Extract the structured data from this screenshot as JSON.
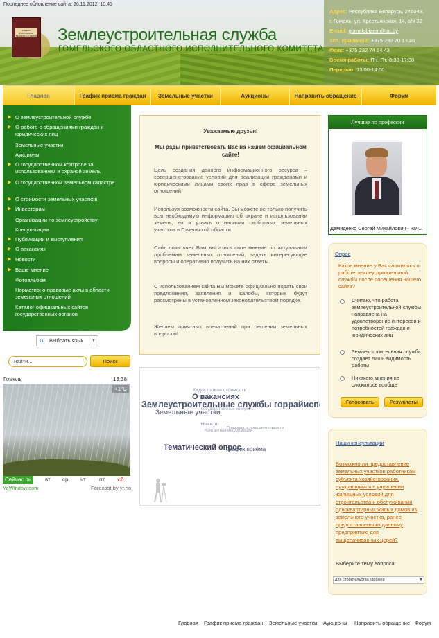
{
  "header": {
    "last_update": "Последнее обновление сайта: 26.11.2012, 10:45",
    "title_main": "Землеустроительная служба",
    "title_sub": "ГОМЕЛЬСКОГО ОБЛАСТНОГО ИСПОЛНИТЕЛЬНОГО КОМИТЕТА",
    "logo_text": "КОДЕКС РЕСПУБЛИКИ БЕЛАРУСЬ О ЗЕМЛЕ",
    "contacts": {
      "address_key": "Адрес:",
      "address_val": "Республика Беларусь, 246048,",
      "address_val2": "г. Гомель, ул. Крестьянская, 14, а/я 32",
      "email_key": "E-mail:",
      "email_val": "gomelobizem@tut.by",
      "phone_key": "Тел. приёмной:",
      "phone_val": "+375 232 70 13 46",
      "fax_key": "Факс:",
      "fax_val": "+375 232 74 54 43",
      "hours_key": "Время работы:",
      "hours_val": "Пн.-Пт. 8:30-17:30",
      "break_key": "Перерыв:",
      "break_val": "13:00-14:00"
    }
  },
  "topnav": [
    "Главная",
    "График приема граждан",
    "Земельные участки",
    "Аукционы",
    "Направить обращение",
    "Форум"
  ],
  "leftnav": [
    "О землеустроительной службе",
    "О работе с обращениями граждан и юридических лиц",
    "Земельные участки",
    "Аукционы",
    "О государственном контроле за использованием и охраной земель",
    "О государственном земельном кадастре",
    "О стоимости земельных участков",
    "Инвесторам",
    "Организации по землеустройству",
    "Консультации",
    "Публикации и выступления",
    "О вакансиях",
    "Новости",
    "Ваше мнение",
    "Фотоальбом",
    "Нормативно-правовые акты в области земельных отношений",
    "Каталог официальных сайтов государственных органов"
  ],
  "translate_label": "Выбрать язык",
  "search": {
    "placeholder": "найти...",
    "button": "Поиск"
  },
  "weather": {
    "city": "Гомель",
    "time": "13:38",
    "temp": "+1°C",
    "days": [
      "Сейчас пн",
      "вт",
      "ср",
      "чт",
      "пт",
      "сб"
    ],
    "brand": "YoWindow.com",
    "forecast": "Forecast by yr.no"
  },
  "welcome": {
    "h1": "Уважаемые друзья!",
    "h2": "Мы рады приветствовать Вас на нашем официальном сайте!",
    "p1": "Цель создания данного информационного ресурса – совершенствование условий для реализации гражданами и юридическими лицами своих прав в сфере земельных отношений.",
    "p2": "Используя возможности сайта, Вы можете не только получить всю необходимую информацию об охране и использовании земель, но и узнать о наличии свободных земельных участков в Гомельской области.",
    "p3": "Сайт позволяет Вам выразить свое мнение по актуальным проблемам земельных отношений, задать интересующие вопросы и оперативно получить на них ответы.",
    "p4": "С использованием сайта Вы можете официально подать свои предложения, заявления и жалобы, которые будут рассмотрены в установленном законодательством порядке.",
    "p5": "Желаем приятных впечатлений при решении земельных вопросов!"
  },
  "cloud": [
    "Кадастровая стоимость",
    "О вакансиях",
    "Землеустроительные службы горрайисполкомов",
    "Государственный контроль",
    "Земельные участки",
    "Новости",
    "Правовая основа деятельности",
    "Контактная информация",
    "Тематический опрос",
    "График приёма"
  ],
  "best": {
    "heading": "Лучшие по профессии",
    "name": "Демиденко Сергей Михайлович - нач..."
  },
  "poll": {
    "title": "Опрос",
    "question": "Какое мнение у Вас сложилось о работе землеустроительной службы после посещения нашего сайта?",
    "options": [
      "Считаю, что работа землеустроительной службы направлена на удовлетворение интересов и потребностей граждан и юридических лиц",
      "Землеустроительная служба создает лишь видимость работы",
      "Никакого мнения не сложилось вообще"
    ],
    "vote": "Голосовать",
    "results": "Результаты"
  },
  "consult": {
    "title": "Наши консультации",
    "question": "Возможно ли предоставление земельных участков работникам субъекта хозяйствования, нуждающимся в улучшении жилищных условий для строительства и обслуживания одноквартирных жилых домов из земельного участка, ранее предоставленного данному предприятию для выщелачиванных церей?",
    "select_label": "Выберите тему вопроса:",
    "select_value": "для строительства гаражей"
  },
  "footer": [
    "Главная",
    "График приема граждан",
    "Земельные участки",
    "Аукционы",
    "Направить обращение",
    "Форум"
  ]
}
